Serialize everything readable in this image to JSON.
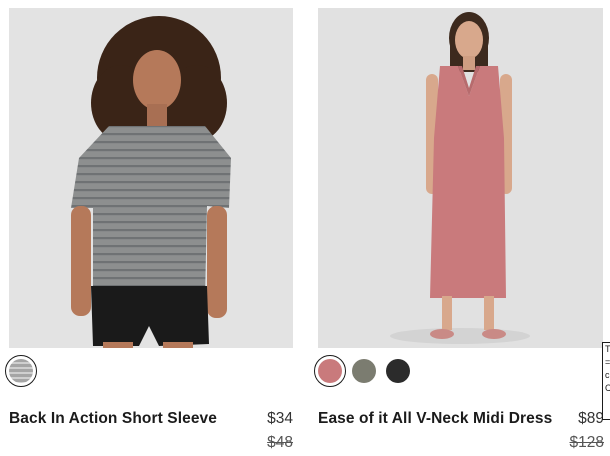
{
  "products": [
    {
      "name": "Back In Action Short Sleeve",
      "sale_price": "$34",
      "original_price": "$48",
      "swatches": [
        {
          "color": "#9a9a9a",
          "label": "heathered grey stripe",
          "selected": true
        }
      ]
    },
    {
      "name": "Ease of it All V-Neck Midi Dress",
      "sale_price": "$89",
      "original_price": "$128",
      "swatches": [
        {
          "color": "#c97a7c",
          "label": "rose",
          "selected": true
        },
        {
          "color": "#7b7c70",
          "label": "olive grey",
          "selected": false
        },
        {
          "color": "#2b2b2b",
          "label": "black",
          "selected": false
        }
      ]
    }
  ],
  "edge_widget": {
    "chars": [
      "T",
      "=",
      "c",
      "C"
    ]
  },
  "colors": {
    "photo_background": "#e3e3e3",
    "text": "#1b1b1b"
  }
}
